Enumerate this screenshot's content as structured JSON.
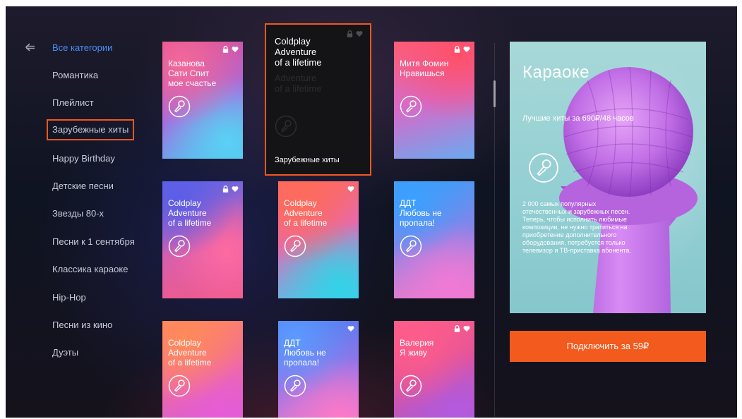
{
  "sidebar": {
    "back_icon": "arrow-left-icon",
    "items": [
      {
        "label": "Все категории"
      },
      {
        "label": "Романтика"
      },
      {
        "label": "Плейлист"
      },
      {
        "label": "Зарубежные хиты"
      },
      {
        "label": "Happy Birthday"
      },
      {
        "label": "Детские песни"
      },
      {
        "label": "Звезды 80-х"
      },
      {
        "label": "Песни к 1 сентября"
      },
      {
        "label": "Классика караоке"
      },
      {
        "label": "Hip-Hop"
      },
      {
        "label": "Песни из кино"
      },
      {
        "label": "Дуэты"
      }
    ]
  },
  "cards": {
    "c1": {
      "lines": [
        "Казанова",
        "Сати Спит",
        "мое счастье"
      ],
      "lock": true,
      "fav": true
    },
    "focused": {
      "lines": [
        "Coldplay",
        "Adventure",
        "of a lifetime"
      ],
      "caption": "Зарубежные хиты",
      "lock": true,
      "fav": true
    },
    "c3": {
      "lines": [
        "Митя Фомин",
        "Нравишься"
      ],
      "lock": true,
      "fav": true
    },
    "c4": {
      "lines": [
        "Coldplay",
        "Adventure",
        "of a lifetime"
      ],
      "lock": true,
      "fav": true
    },
    "c5": {
      "lines": [
        "Coldplay",
        "Adventure",
        "of a lifetime"
      ],
      "lock": false,
      "fav": true
    },
    "c6": {
      "lines": [
        "ДДТ",
        "Любовь не",
        "пропала!"
      ],
      "lock": false,
      "fav": false
    },
    "c7": {
      "lines": [
        "Coldplay",
        "Adventure",
        "of a lifetime"
      ],
      "lock": false,
      "fav": false
    },
    "c8": {
      "lines": [
        "ДДТ",
        "Любовь не",
        "пропала!"
      ],
      "lock": false,
      "fav": true
    },
    "c9": {
      "lines": [
        "Валерия",
        "Я живу"
      ],
      "lock": true,
      "fav": true
    }
  },
  "promo": {
    "title": "Караоке",
    "subtitle": "Лучшие хиты за 690₽/48 часов",
    "description_lines": [
      "2 000 самых популярных",
      "отечественных и зарубежных песен.",
      "Теперь, чтобы исполнить любимые",
      "композиции, не нужно тратиться на",
      "приобретение дополнительного",
      "оборудования, потребуется только",
      "телевизор и ТВ-приставка абонента."
    ],
    "icon": "microphone-icon"
  },
  "buy_button": {
    "label": "Подключить за 59₽"
  },
  "colors": {
    "accent": "#f0571f",
    "active_category": "#4a8ef5",
    "button": "#f25a1e"
  }
}
